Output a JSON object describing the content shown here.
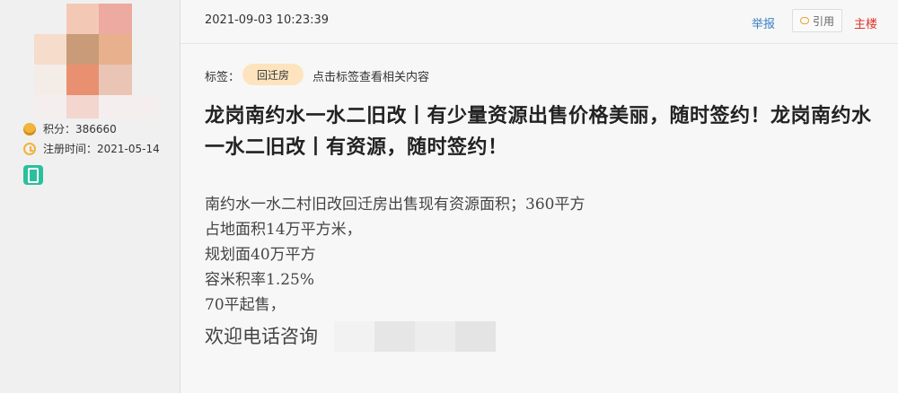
{
  "post": {
    "timestamp": "2021-09-03 10:23:39",
    "actions": {
      "report": "举报",
      "quote": "引用",
      "op": "主楼"
    },
    "tags": {
      "label": "标签：",
      "tag": "回迁房",
      "hint": "点击标签查看相关内容"
    },
    "title": "龙岗南约水一水二旧改丨有少量资源出售价格美丽，随时签约！龙岗南约水一水二旧改丨有资源，随时签约！",
    "body_lines": [
      "南约水一水二村旧改回迁房出售现有资源面积；360平方",
      "占地面积14万平方米，",
      "规划面40万平方",
      "容米积率1.25%",
      "70平起售，"
    ],
    "contact_text": "欢迎电话咨询"
  },
  "user": {
    "points": "积分：386660",
    "register": "注册时间：2021-05-14"
  },
  "icons": {
    "points": "coin-icon",
    "register": "clock-icon",
    "mobile": "mobile-icon",
    "quote": "speech-bubble-icon"
  },
  "colors": {
    "report": "#3b80c4",
    "op": "#e0352b",
    "tag_bg": "#fde4bf",
    "mobile_badge": "#2bbf9e"
  }
}
